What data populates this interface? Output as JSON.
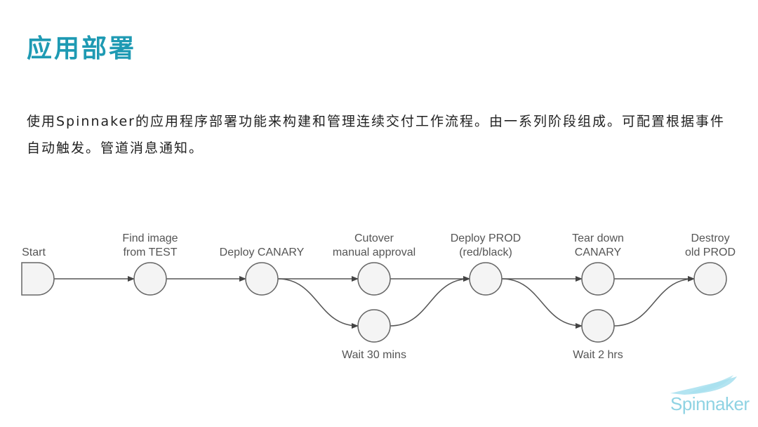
{
  "slide": {
    "title": "应用部署",
    "description": "使用Spinnaker的应用程序部署功能来构建和管理连续交付工作流程。由一系列阶段组成。可配置根据事件自动触发。管道消息通知。",
    "logo_text": "Spinnaker",
    "accent_color": "#1e9ab3"
  },
  "diagram": {
    "nodes": [
      {
        "id": "start",
        "shape": "start",
        "label": [
          "Start"
        ],
        "col": 0,
        "row": 0,
        "label_pos": "above"
      },
      {
        "id": "find-image",
        "shape": "circle",
        "label": [
          "Find image",
          "from TEST"
        ],
        "col": 1,
        "row": 0,
        "label_pos": "above"
      },
      {
        "id": "deploy-canary",
        "shape": "circle",
        "label": [
          "Deploy CANARY"
        ],
        "col": 2,
        "row": 0,
        "label_pos": "above"
      },
      {
        "id": "cutover",
        "shape": "circle",
        "label": [
          "Cutover",
          "manual approval"
        ],
        "col": 3,
        "row": 0,
        "label_pos": "above"
      },
      {
        "id": "wait-30",
        "shape": "circle",
        "label": [
          "Wait 30 mins"
        ],
        "col": 3,
        "row": 1,
        "label_pos": "below"
      },
      {
        "id": "deploy-prod",
        "shape": "circle",
        "label": [
          "Deploy PROD",
          "(red/black)"
        ],
        "col": 4,
        "row": 0,
        "label_pos": "above"
      },
      {
        "id": "tear-down",
        "shape": "circle",
        "label": [
          "Tear down",
          "CANARY"
        ],
        "col": 5,
        "row": 0,
        "label_pos": "above"
      },
      {
        "id": "wait-2",
        "shape": "circle",
        "label": [
          "Wait 2 hrs"
        ],
        "col": 5,
        "row": 1,
        "label_pos": "below"
      },
      {
        "id": "destroy",
        "shape": "circle",
        "label": [
          "Destroy",
          "old PROD"
        ],
        "col": 6,
        "row": 0,
        "label_pos": "above"
      }
    ],
    "edges": [
      {
        "from": "start",
        "to": "find-image"
      },
      {
        "from": "find-image",
        "to": "deploy-canary"
      },
      {
        "from": "deploy-canary",
        "to": "cutover"
      },
      {
        "from": "deploy-canary",
        "to": "wait-30"
      },
      {
        "from": "cutover",
        "to": "deploy-prod"
      },
      {
        "from": "wait-30",
        "to": "deploy-prod"
      },
      {
        "from": "deploy-prod",
        "to": "tear-down"
      },
      {
        "from": "deploy-prod",
        "to": "wait-2"
      },
      {
        "from": "tear-down",
        "to": "destroy"
      },
      {
        "from": "wait-2",
        "to": "destroy"
      }
    ]
  }
}
